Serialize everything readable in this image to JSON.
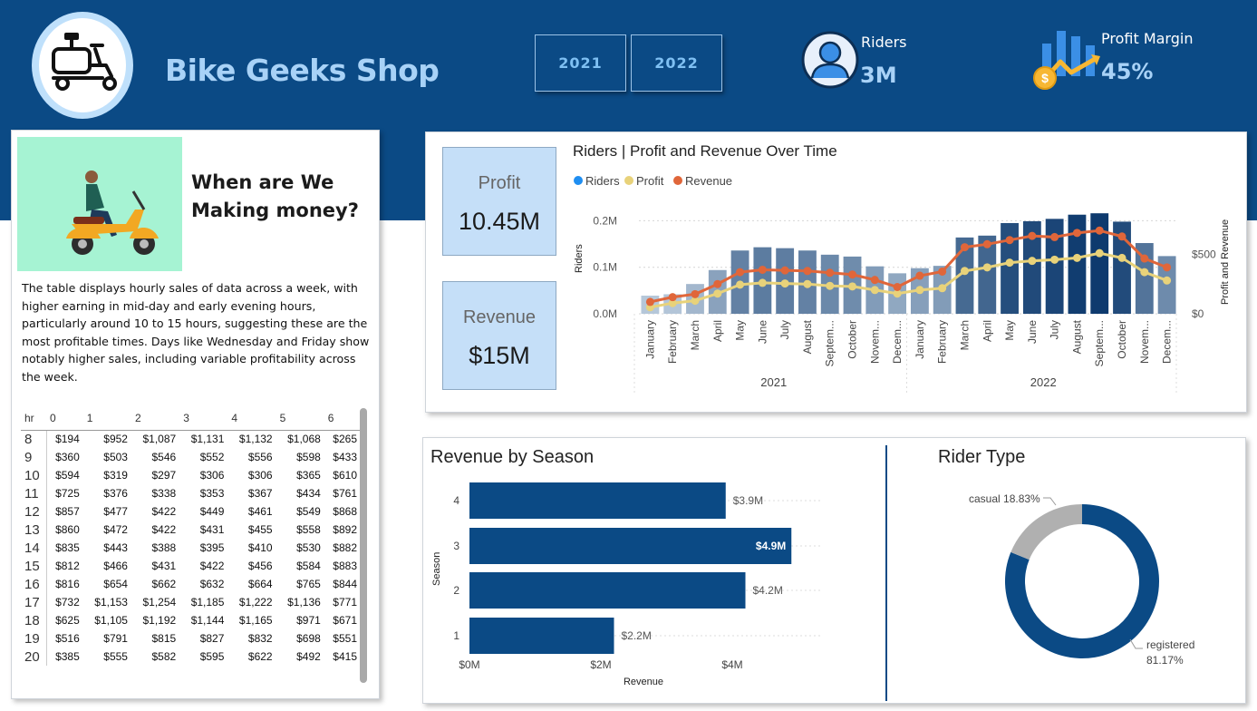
{
  "app_title": "Bike Geeks Shop",
  "year_buttons": [
    "2021",
    "2022"
  ],
  "kpi_riders": {
    "label": "Riders",
    "value": "3M"
  },
  "kpi_profit_margin": {
    "label": "Profit Margin",
    "value": "45%"
  },
  "left_panel": {
    "heading": "When are We Making money?",
    "description": "The table displays hourly sales of data across a week, with higher earning in mid-day and early evening hours, particularly around 10 to 15 hours, suggesting these are the most profitable times. Days like Wednesday and Friday show notably higher sales, including variable profitability across the week.",
    "table": {
      "headers": [
        "hr",
        "0",
        "1",
        "2",
        "3",
        "4",
        "5",
        "6"
      ],
      "rows": [
        [
          "8",
          "$194",
          "$952",
          "$1,087",
          "$1,131",
          "$1,132",
          "$1,068",
          "$265"
        ],
        [
          "9",
          "$360",
          "$503",
          "$546",
          "$552",
          "$556",
          "$598",
          "$433"
        ],
        [
          "10",
          "$594",
          "$319",
          "$297",
          "$306",
          "$306",
          "$365",
          "$610"
        ],
        [
          "11",
          "$725",
          "$376",
          "$338",
          "$353",
          "$367",
          "$434",
          "$761"
        ],
        [
          "12",
          "$857",
          "$477",
          "$422",
          "$449",
          "$461",
          "$549",
          "$868"
        ],
        [
          "13",
          "$860",
          "$472",
          "$422",
          "$431",
          "$455",
          "$558",
          "$892"
        ],
        [
          "14",
          "$835",
          "$443",
          "$388",
          "$395",
          "$410",
          "$530",
          "$882"
        ],
        [
          "15",
          "$812",
          "$466",
          "$431",
          "$422",
          "$456",
          "$584",
          "$883"
        ],
        [
          "16",
          "$816",
          "$654",
          "$662",
          "$632",
          "$664",
          "$765",
          "$844"
        ],
        [
          "17",
          "$732",
          "$1,153",
          "$1,254",
          "$1,185",
          "$1,222",
          "$1,136",
          "$771"
        ],
        [
          "18",
          "$625",
          "$1,105",
          "$1,192",
          "$1,144",
          "$1,165",
          "$971",
          "$671"
        ],
        [
          "19",
          "$516",
          "$791",
          "$815",
          "$827",
          "$832",
          "$698",
          "$551"
        ],
        [
          "20",
          "$385",
          "$555",
          "$582",
          "$595",
          "$622",
          "$492",
          "$415"
        ]
      ]
    }
  },
  "kpi_profit_box": {
    "label": "Profit",
    "value": "10.45M"
  },
  "kpi_revenue_box": {
    "label": "Revenue",
    "value": "$15M"
  },
  "colors": {
    "header": "#0b4a85",
    "riders": "#1f8ef1",
    "profit": "#e8d27a",
    "revenue": "#e0663a",
    "bar_dark": "#0b4a85",
    "donut_registered": "#0b4a85",
    "donut_casual": "#b0b0b0"
  },
  "chart_data": [
    {
      "type": "bar+line",
      "title": "Riders | Profit and Revenue Over Time",
      "legend": [
        "Riders",
        "Profit",
        "Revenue"
      ],
      "legend_position": "top-left",
      "x_months": [
        "January",
        "February",
        "March",
        "April",
        "May",
        "June",
        "July",
        "August",
        "Septem...",
        "October",
        "Novem...",
        "Decem...",
        "January",
        "February",
        "March",
        "April",
        "May",
        "June",
        "July",
        "August",
        "Septem...",
        "October",
        "Novem...",
        "Decem..."
      ],
      "x_years": [
        "2021",
        "2022"
      ],
      "y_left_ticks": [
        "0.0M",
        "0.1M",
        "0.2M"
      ],
      "y_left_lim": [
        0,
        0.23
      ],
      "y_right_ticks": [
        "$0",
        "$500"
      ],
      "y_right_label": "Profit and Revenue",
      "y_left_label": "Riders",
      "y_right_lim": [
        0,
        900
      ],
      "series": [
        {
          "name": "Riders",
          "values": [
            0.039,
            0.042,
            0.064,
            0.094,
            0.136,
            0.143,
            0.141,
            0.136,
            0.127,
            0.123,
            0.102,
            0.087,
            0.098,
            0.103,
            0.164,
            0.168,
            0.195,
            0.199,
            0.204,
            0.213,
            0.216,
            0.198,
            0.152,
            0.124
          ]
        },
        {
          "name": "Profit",
          "values": [
            55,
            90,
            110,
            170,
            245,
            260,
            255,
            250,
            235,
            230,
            200,
            170,
            200,
            215,
            360,
            390,
            430,
            445,
            455,
            470,
            510,
            470,
            350,
            280
          ]
        },
        {
          "name": "Revenue",
          "values": [
            100,
            140,
            165,
            250,
            350,
            370,
            365,
            360,
            345,
            330,
            285,
            225,
            320,
            355,
            560,
            585,
            620,
            655,
            645,
            680,
            700,
            650,
            465,
            390
          ]
        }
      ]
    },
    {
      "type": "bar",
      "orientation": "horizontal",
      "title": "Revenue by Season",
      "categories": [
        "4",
        "3",
        "2",
        "1"
      ],
      "values": [
        3.9,
        4.9,
        4.2,
        2.2
      ],
      "data_labels": [
        "$3.9M",
        "$4.9M",
        "$4.2M",
        "$2.2M"
      ],
      "xlabel": "Revenue",
      "ylabel": "Season",
      "x_ticks": [
        "$0M",
        "$2M",
        "$4M"
      ],
      "xlim": [
        0,
        5.5
      ]
    },
    {
      "type": "pie",
      "title": "Rider Type",
      "slices": [
        {
          "name": "registered",
          "value": 81.17,
          "label": "81.17%"
        },
        {
          "name": "casual",
          "value": 18.83,
          "label": "18.83%"
        }
      ]
    }
  ]
}
